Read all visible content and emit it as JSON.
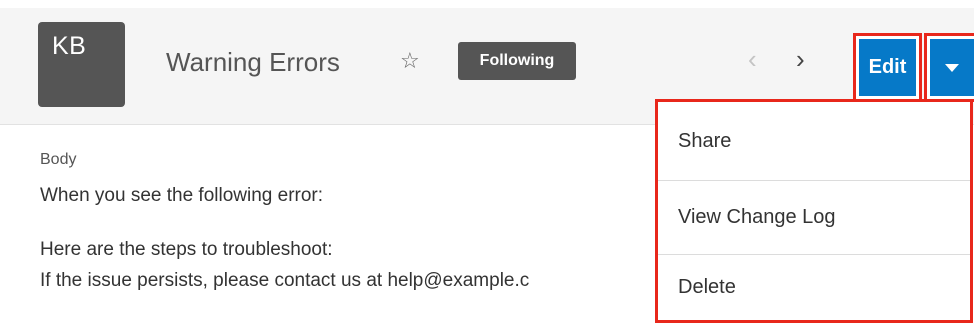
{
  "header": {
    "avatar_initials": "KB",
    "title": "Warning Errors",
    "favorite_icon": "star-outline-icon",
    "following_label": "Following",
    "prev_icon": "chevron-left-icon",
    "next_icon": "chevron-right-icon",
    "edit_label": "Edit",
    "actions_icon": "caret-down-icon"
  },
  "content": {
    "field_label": "Body",
    "paragraphs": [
      "When you see the following error:",
      "Here are the steps to troubleshoot:",
      "If the issue persists, please contact us at help@example.c"
    ]
  },
  "actions_menu": {
    "items": [
      {
        "label": "Share"
      },
      {
        "label": "View Change Log"
      },
      {
        "label": "Delete"
      }
    ]
  },
  "colors": {
    "primary": "#0679c8",
    "highlight": "#e8271b",
    "avatar": "#555555",
    "header_bg": "#f5f5f5"
  }
}
